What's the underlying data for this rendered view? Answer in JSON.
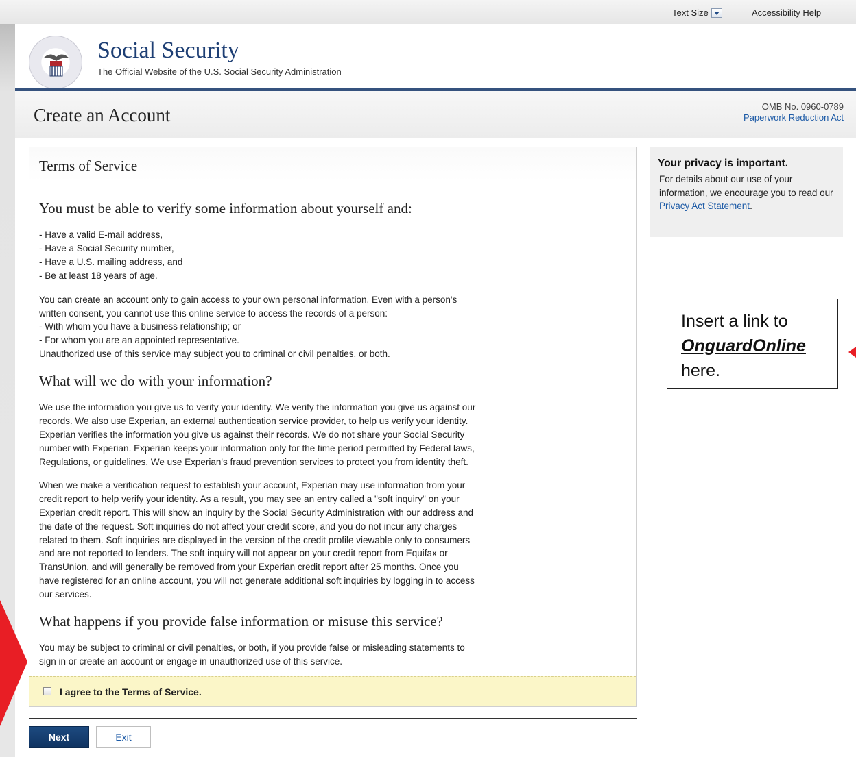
{
  "utility": {
    "text_size": "Text Size",
    "accessibility_help": "Accessibility Help"
  },
  "header": {
    "title": "Social Security",
    "subtitle": "The Official Website of the U.S. Social Security Administration"
  },
  "page": {
    "title": "Create an Account",
    "omb": "OMB No. 0960-0789",
    "paperwork": "Paperwork Reduction Act"
  },
  "panel": {
    "title": "Terms of Service",
    "section1": {
      "heading": "You must be able to verify some information about yourself and:",
      "items": [
        "- Have a valid E-mail address,",
        "- Have a Social Security number,",
        "- Have a U.S. mailing address, and",
        "- Be at least 18 years of age."
      ],
      "para": [
        "You can create an account only to gain access to your own personal information. Even with a person's",
        "written consent, you cannot use this online service to access the records of a person:",
        "- With whom you have a business relationship; or",
        "- For whom you are an appointed representative.",
        "Unauthorized use of this service may subject you to criminal or civil penalties, or both."
      ]
    },
    "section2": {
      "heading": "What will we do with your information?",
      "para1": [
        "We use the information you give us to verify your identity. We verify the information you give us against our",
        "records. We also use Experian, an external authentication service provider, to help us verify your identity.",
        "Experian verifies the information you give us against their records. We do not share your Social Security",
        "number with Experian. Experian keeps your information only for the time period permitted by Federal laws,",
        "Regulations, or guidelines. We use Experian's fraud prevention services to protect you from identity theft."
      ],
      "para2": [
        "When we make a verification request to establish your account, Experian may use information from your",
        "credit report to help verify your identity. As a result, you may see an entry called a \"soft inquiry\" on your",
        "Experian credit report. This will show an inquiry by the Social Security Administration with our address and",
        "the date of the request. Soft inquiries do not affect your credit score, and you do not incur any charges",
        "related to them. Soft inquiries are displayed in the version of the credit profile viewable only to consumers",
        "and are not reported to lenders. The soft inquiry will not appear on your credit report from Equifax or",
        "TransUnion, and will generally be removed from your Experian credit report after 25 months. Once you",
        "have registered for an online account, you will not generate additional soft inquiries by logging in to access",
        "our services."
      ]
    },
    "section3": {
      "heading": "What happens if you provide false information or misuse this service?",
      "para": [
        "You may be subject to criminal or civil penalties, or both, if you provide false or misleading statements to",
        "sign in or create an account or engage in unauthorized use of this service."
      ]
    },
    "agree_label": "I agree to the Terms of Service."
  },
  "buttons": {
    "next": "Next",
    "exit": "Exit"
  },
  "privacy": {
    "title": "Your privacy is important.",
    "text_before": "For details about our use of your information, we encourage you to read our ",
    "link": "Privacy Act Statement",
    "text_after": "."
  },
  "callout": {
    "line1": "Insert a link to",
    "emph": "OnguardOnline",
    "line3": "here."
  }
}
